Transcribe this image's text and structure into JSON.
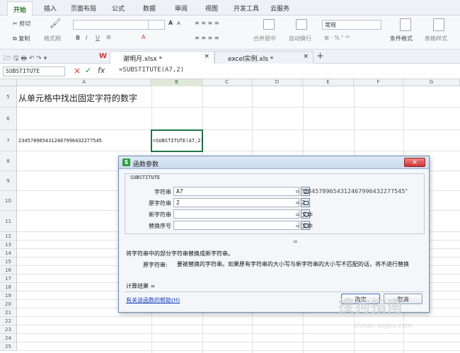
{
  "ribbon_tabs": [
    "开始",
    "插入",
    "页面布局",
    "公式",
    "数据",
    "审阅",
    "视图",
    "开发工具",
    "云服务"
  ],
  "ribbon": {
    "cut": "剪切",
    "copy": "复制",
    "format_painter": "格式刷",
    "font_size": "",
    "number_format": "常规",
    "merge_center": "合并居中",
    "wrap_text": "自动换行",
    "conditional_format": "条件格式",
    "table_style": "表格样式",
    "font_grow": "A",
    "font_shrink": "A",
    "bold": "B",
    "italic": "I",
    "underline": "U"
  },
  "doc_tabs": [
    {
      "label": "谢明月.xlsx *",
      "close": "×"
    },
    {
      "label": "excel实例.xls *",
      "close": "×"
    }
  ],
  "new_tab": "+",
  "formula_bar": {
    "name_box": "SUBSTITUTE",
    "cancel": "×",
    "confirm": "✓",
    "fx": "fx",
    "formula": "=SUBSTITUTE(A7,2)"
  },
  "columns": [
    "A",
    "B",
    "C",
    "D",
    "E",
    "F",
    "G"
  ],
  "rows": [
    {
      "n": "5",
      "a": "从单元格中找出固定字符的数字",
      "b": ""
    },
    {
      "n": "6",
      "a": "",
      "b": ""
    },
    {
      "n": "7",
      "a": "2345789654312467996432277545",
      "b": "=SUBSTITUTE(A7,2)"
    },
    {
      "n": "8",
      "a": "",
      "b": ""
    },
    {
      "n": "9",
      "a": "",
      "b": ""
    },
    {
      "n": "10",
      "a": "",
      "b": ""
    },
    {
      "n": "11",
      "a": "",
      "b": ""
    },
    {
      "n": "12",
      "a": "",
      "b": ""
    },
    {
      "n": "13",
      "a": "",
      "b": ""
    },
    {
      "n": "14",
      "a": "",
      "b": ""
    },
    {
      "n": "15",
      "a": "",
      "b": ""
    },
    {
      "n": "16",
      "a": "",
      "b": ""
    },
    {
      "n": "17",
      "a": "",
      "b": ""
    },
    {
      "n": "18",
      "a": "",
      "b": ""
    },
    {
      "n": "19",
      "a": "",
      "b": ""
    },
    {
      "n": "20",
      "a": "",
      "b": ""
    },
    {
      "n": "21",
      "a": "",
      "b": ""
    },
    {
      "n": "22",
      "a": "",
      "b": ""
    },
    {
      "n": "23",
      "a": "",
      "b": ""
    },
    {
      "n": "24",
      "a": "",
      "b": ""
    },
    {
      "n": "25",
      "a": "",
      "b": ""
    }
  ],
  "dialog": {
    "title": "函数参数",
    "close": "×",
    "function_name": "SUBSTITUTE",
    "params": [
      {
        "label": "字符串",
        "value": "A7",
        "result": "= \"2345789654312467996432277545\""
      },
      {
        "label": "原字符串",
        "value": "2",
        "result": "= 2"
      },
      {
        "label": "新字符串",
        "value": "",
        "result": "= 文本"
      },
      {
        "label": "替换序号",
        "value": "",
        "result": "= 文本"
      }
    ],
    "eq": "=",
    "description": "将字符串中的部分字符串替换成新字符串。",
    "param_label": "原字符串:",
    "param_desc": "要被替换的字符串。如果原有字符串的大小写与新字符串的大小写不匹配的话，将不进行替换",
    "calc_result": "计算结果 =",
    "help_link": "有关该函数的帮助(H)",
    "ok": "确定",
    "cancel": "取消"
  },
  "watermark": "搜狗指南",
  "watermark_url": "zhinan.sogou.com",
  "colors": {
    "accent_green": "#2e7d32",
    "link": "#1a3fb5",
    "selection": "#217346"
  }
}
